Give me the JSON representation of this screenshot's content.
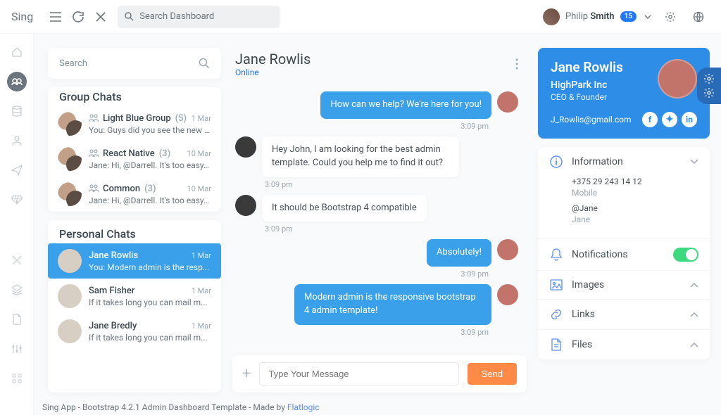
{
  "topbar": {
    "logo": "Sing",
    "search_placeholder": "Search Dashboard",
    "user_first": "Philip",
    "user_last": "Smith",
    "badge": "15"
  },
  "chat_search_placeholder": "Search",
  "group_chats_title": "Group Chats",
  "group_chats": [
    {
      "name": "Light Blue Group",
      "count": "(5)",
      "date": "1 Mar",
      "preview": "You:  Guys did you see the new u..."
    },
    {
      "name": "React Native",
      "count": "(3)",
      "date": "10 Mar",
      "preview": "Jane:  Hi, @Darrell. It's too easy. I c..."
    },
    {
      "name": "Common",
      "count": "(3)",
      "date": "10 Mar",
      "preview": "Jane:  Hi, @Darrell. It's too easy. I c..."
    }
  ],
  "personal_chats_title": "Personal Chats",
  "personal_chats": [
    {
      "name": "Jane Rowlis",
      "date": "1 Mar",
      "preview": "You:  Modern admin is the resp...",
      "active": true
    },
    {
      "name": "Sam Fisher",
      "date": "1 Mar",
      "preview": "If it takes long you can mail m..."
    },
    {
      "name": "Jane Bredly",
      "date": "1 Mar",
      "preview": "If it takes long you can mail m..."
    }
  ],
  "conversation": {
    "name": "Jane Rowlis",
    "status": "Online",
    "messages": [
      {
        "dir": "out",
        "text": "How can we help? We're here for you!",
        "time": "3:09 pm"
      },
      {
        "dir": "in",
        "text": "Hey John, I am looking for the best admin template. Could you help me to find it out?",
        "time": "3:09 pm"
      },
      {
        "dir": "in",
        "text": "It should be Bootstrap 4 compatible",
        "time": "3:09 pm"
      },
      {
        "dir": "out",
        "text": "Absolutely!",
        "time": "3:09 pm"
      },
      {
        "dir": "out",
        "text": "Modern admin is the responsive bootstrap 4 admin template!",
        "time": "3:09 pm"
      }
    ],
    "input_placeholder": "Type Your Message",
    "send_label": "Send"
  },
  "profile": {
    "name": "Jane Rowlis",
    "company": "HighPark Inc",
    "role": "CEO & Founder",
    "email": "J_Rowlis@gmail.com"
  },
  "info_panel": {
    "title": "Information",
    "phone": "+375 29 243 14 12",
    "phone_label": "Mobile",
    "handle": "@Jane",
    "handle_label": "Jane"
  },
  "panels": {
    "notifications": "Notifications",
    "images": "Images",
    "links": "Links",
    "files": "Files"
  },
  "footer": {
    "text": "Sing App - Bootstrap 4.2.1 Admin Dashboard Template - Made by ",
    "link": "Flatlogic"
  }
}
